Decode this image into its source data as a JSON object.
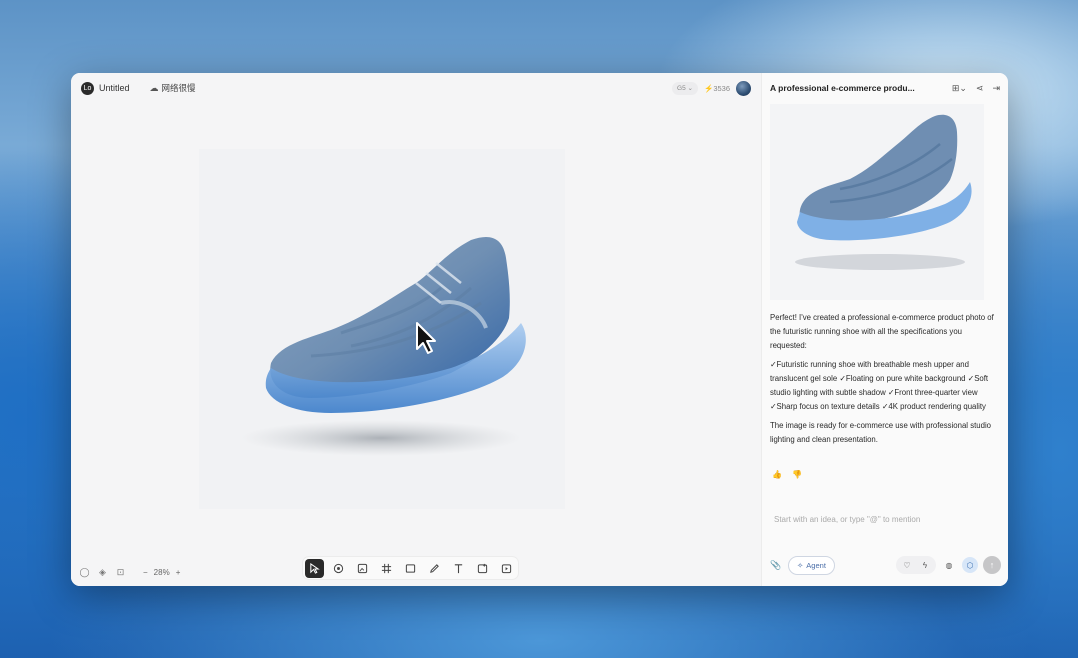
{
  "canvas": {
    "logo_label": "Lo",
    "title": "Untitled",
    "network_label": "网络很慢",
    "mode_pill": "G5 ⌄",
    "credits": "3536",
    "zoom": "28%",
    "zoom_minus": "−",
    "zoom_plus": "+"
  },
  "tools": [
    "select-tool",
    "mark-tool",
    "image-gen-tool",
    "frame-tool",
    "rectangle-tool",
    "pen-tool",
    "text-tool",
    "upload-image-tool",
    "video-gen-tool"
  ],
  "chat": {
    "title": "A professional e-commerce produ...",
    "message_intro": "Perfect! I've created a professional e-commerce product photo of the futuristic running shoe with all the specifications you requested:",
    "message_specs": "✓Futuristic running shoe with breathable mesh upper and translucent gel sole ✓Floating on pure white background ✓Soft studio lighting with subtle shadow ✓Front three-quarter view ✓Sharp focus on texture details ✓4K product rendering quality",
    "message_outro": "The image is ready for e-commerce use with professional studio lighting and clean presentation.",
    "prompt_placeholder": "Start with an idea, or type \"@\" to mention",
    "agent_label": "Agent"
  }
}
